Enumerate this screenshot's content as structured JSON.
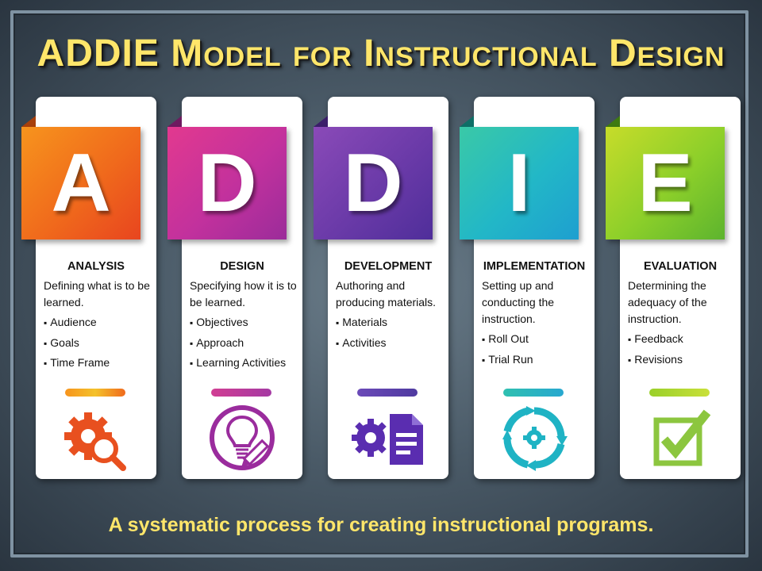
{
  "title": "ADDIE Model for Instructional Design",
  "tagline": "A systematic process for creating instructional programs.",
  "stages": [
    {
      "letter": "A",
      "name": "ANALYSIS",
      "description": "Defining what is to be learned.",
      "bullets": [
        "Audience",
        "Goals",
        "Time Frame"
      ],
      "icon": "gear-magnifier-icon",
      "color": "#f06a1c"
    },
    {
      "letter": "D",
      "name": "DESIGN",
      "description": "Specifying how it is to be learned.",
      "bullets": [
        "Objectives",
        "Approach",
        "Learning Activities"
      ],
      "icon": "lightbulb-pencil-icon",
      "color": "#b02f98"
    },
    {
      "letter": "D",
      "name": "DEVELOPMENT",
      "description": "Authoring and producing materials.",
      "bullets": [
        "Materials",
        "Activities"
      ],
      "icon": "gear-document-icon",
      "color": "#6a3aa8"
    },
    {
      "letter": "I",
      "name": "IMPLEMENTATION",
      "description": "Setting up and conducting the instruction.",
      "bullets": [
        "Roll Out",
        "Trial Run"
      ],
      "icon": "cycle-gear-icon",
      "color": "#22b7c7"
    },
    {
      "letter": "E",
      "name": "EVALUATION",
      "description": "Determining the adequacy of the instruction.",
      "bullets": [
        "Feedback",
        "Revisions"
      ],
      "icon": "checkbox-icon",
      "color": "#8ccf2a"
    }
  ]
}
